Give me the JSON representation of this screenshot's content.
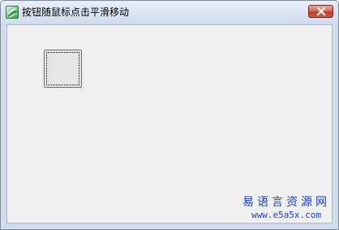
{
  "window": {
    "title": "按钮随鼠标点击平滑移动",
    "app_icon": "app-icon",
    "close_icon": "close-icon"
  },
  "client": {
    "button_label": "",
    "background_color": "#f0f0f0"
  },
  "watermark": {
    "site_name": "易语言资源网",
    "url": "www.e5a5x.com",
    "color": "#1a3fd6"
  },
  "colors": {
    "close_button": "#c0412a"
  }
}
